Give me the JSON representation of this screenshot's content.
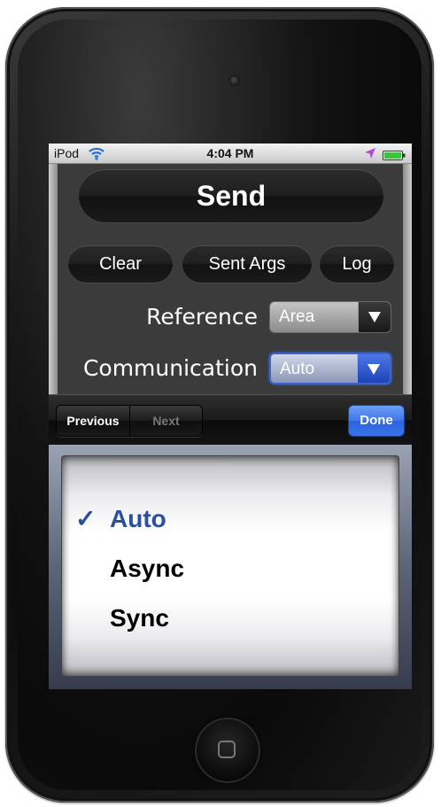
{
  "status_bar": {
    "carrier": "iPod",
    "time": "4:04 PM",
    "wifi_icon": "wifi-icon",
    "location_icon": "location-arrow-icon",
    "battery_icon": "battery-icon",
    "battery_color": "#3cc23c",
    "location_color": "#b04bd6"
  },
  "main": {
    "send_label": "Send",
    "clear_label": "Clear",
    "sent_args_label": "Sent Args",
    "log_label": "Log",
    "reference": {
      "label": "Reference",
      "value": "Area"
    },
    "communication": {
      "label": "Communication",
      "value": "Auto"
    }
  },
  "toolbar": {
    "previous_label": "Previous",
    "next_label": "Next",
    "done_label": "Done",
    "done_color": "#3f77e9"
  },
  "picker": {
    "check_mark": "✓",
    "selected_color": "#2a4f9f",
    "options": [
      {
        "label": "Auto",
        "selected": true
      },
      {
        "label": "Async",
        "selected": false
      },
      {
        "label": "Sync",
        "selected": false
      }
    ]
  }
}
